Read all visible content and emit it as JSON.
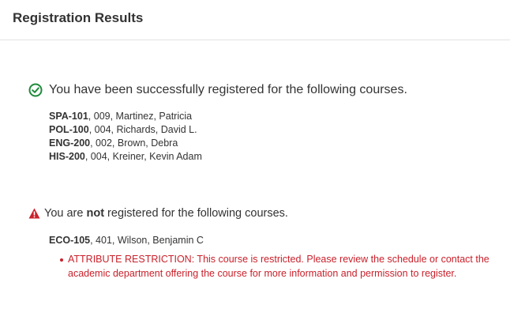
{
  "header": {
    "title": "Registration Results"
  },
  "success": {
    "message": "You have been successfully registered for the following courses.",
    "icon": "check-circle-icon",
    "color": "#1f8a3b",
    "courses": [
      {
        "code": "SPA-101",
        "details": ", 009, Martinez, Patricia"
      },
      {
        "code": "POL-100",
        "details": ", 004, Richards, David L."
      },
      {
        "code": "ENG-200",
        "details": ", 002, Brown, Debra"
      },
      {
        "code": "HIS-200",
        "details": ", 004, Kreiner, Kevin Adam"
      }
    ]
  },
  "failure": {
    "message_prefix": "You are ",
    "message_emphasis": "not",
    "message_suffix": " registered for the following courses.",
    "icon": "warning-triangle-icon",
    "color": "#c9212b",
    "courses": [
      {
        "code": "ECO-105",
        "details": ", 401, Wilson, Benjamin C",
        "reasons": [
          "ATTRIBUTE RESTRICTION: This course is restricted.  Please review the schedule or contact the academic department offering the course for more information and permission to register."
        ]
      }
    ]
  }
}
